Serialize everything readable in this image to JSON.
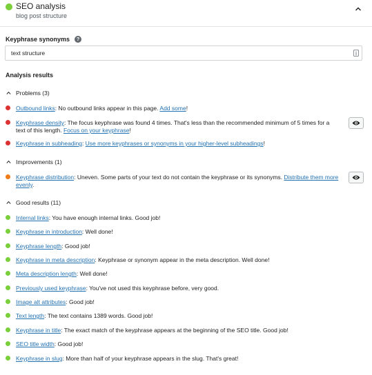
{
  "header": {
    "title": "SEO analysis",
    "subtitle": "blog post structure",
    "status_color": "#7ad03a",
    "collapse_icon": "chevron-up-icon"
  },
  "synonyms": {
    "label": "Keyphrase synonyms",
    "help_icon": "?",
    "value": "text structure"
  },
  "analysis": {
    "heading": "Analysis results",
    "colors": {
      "bad": "#dc3232",
      "ok": "#ee7c1b",
      "good": "#7ad03a"
    },
    "problems": {
      "label": "Problems (3)",
      "items": [
        {
          "link": "Outbound links",
          "text": ": No outbound links appear in this page. ",
          "action": "Add some",
          "end": "!"
        },
        {
          "link": "Keyphrase density",
          "text": ": The focus keyphrase was found 4 times. That's less than the recommended minimum of 5 times for a text of this length. ",
          "action": "Focus on your keyphrase",
          "end": "!"
        },
        {
          "link": "Keyphrase in subheading",
          "text": ": ",
          "action": "Use more keyphrases or synonyms in your higher-level subheadings",
          "end": "!"
        }
      ]
    },
    "improvements": {
      "label": "Improvements (1)",
      "items": [
        {
          "link": "Keyphrase distribution",
          "text": ": Uneven. Some parts of your text do not contain the keyphrase or its synonyms. ",
          "action": "Distribute them more evenly",
          "end": "."
        }
      ]
    },
    "good": {
      "label": "Good results (11)",
      "items": [
        {
          "link": "Internal links",
          "text": ": You have enough internal links. Good job!"
        },
        {
          "link": "Keyphrase in introduction",
          "text": ": Well done!"
        },
        {
          "link": "Keyphrase length",
          "text": ": Good job!"
        },
        {
          "link": "Keyphrase in meta description",
          "text": ": Keyphrase or synonym appear in the meta description. Well done!"
        },
        {
          "link": "Meta description length",
          "text": ": Well done!"
        },
        {
          "link": "Previously used keyphrase",
          "text": ": You've not used this keyphrase before, very good."
        },
        {
          "link": "Image alt attributes",
          "text": ": Good job!"
        },
        {
          "link": "Text length",
          "text": ": The text contains 1389 words. Good job!"
        },
        {
          "link": "Keyphrase in title",
          "text": ": The exact match of the keyphrase appears at the beginning of the SEO title. Good job!"
        },
        {
          "link": "SEO title width",
          "text": ": Good job!"
        },
        {
          "link": "Keyphrase in slug",
          "text": ": More than half of your keyphrase appears in the slug. That's great!"
        }
      ]
    }
  }
}
